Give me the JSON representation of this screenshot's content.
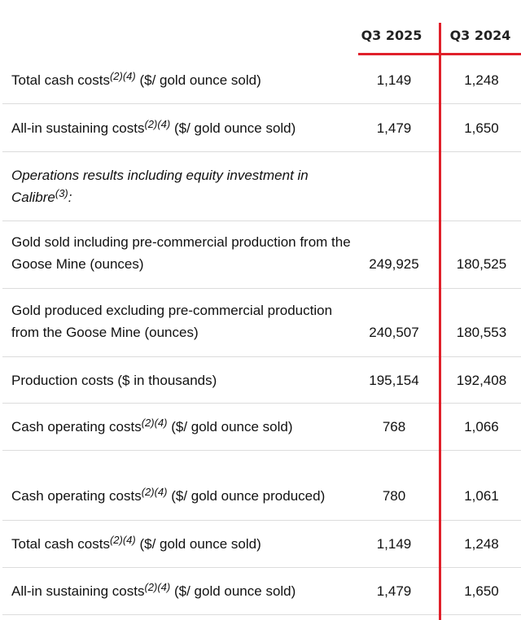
{
  "header": {
    "col1": "Q3 2025",
    "col2": "Q3 2024"
  },
  "rows": [
    {
      "pre": "Total cash costs",
      "sup": "(2)(4)",
      "post": " ($/ gold ounce sold)",
      "v1": "1,149",
      "v2": "1,248"
    },
    {
      "pre": "All-in sustaining costs",
      "sup": "(2)(4)",
      "post": " ($/ gold ounce sold)",
      "v1": "1,479",
      "v2": "1,650"
    },
    {
      "pre": "Operations results including equity investment in Calibre",
      "sup": "(3)",
      "post": ":",
      "v1": "",
      "v2": ""
    },
    {
      "pre": "Gold sold including pre-commercial production from the Goose Mine (ounces)",
      "sup": "",
      "post": "",
      "v1": "249,925",
      "v2": "180,525"
    },
    {
      "pre": "Gold produced excluding pre-commercial production from the Goose Mine (ounces)",
      "sup": "",
      "post": "",
      "v1": "240,507",
      "v2": "180,553"
    },
    {
      "pre": "Production costs ($ in thousands)",
      "sup": "",
      "post": "",
      "v1": "195,154",
      "v2": "192,408"
    },
    {
      "pre": "Cash operating costs",
      "sup": "(2)(4)",
      "post": " ($/ gold ounce sold)",
      "v1": "768",
      "v2": "1,066"
    },
    {
      "pre": "Cash operating costs",
      "sup": "(2)(4)",
      "post": " ($/ gold ounce produced)",
      "v1": "780",
      "v2": "1,061"
    },
    {
      "pre": "Total cash costs",
      "sup": "(2)(4)",
      "post": " ($/ gold ounce sold)",
      "v1": "1,149",
      "v2": "1,248"
    },
    {
      "pre": "All-in sustaining costs",
      "sup": "(2)(4)",
      "post": " ($/ gold ounce sold)",
      "v1": "1,479",
      "v2": "1,650"
    }
  ],
  "annotation_color": "#e0202a"
}
